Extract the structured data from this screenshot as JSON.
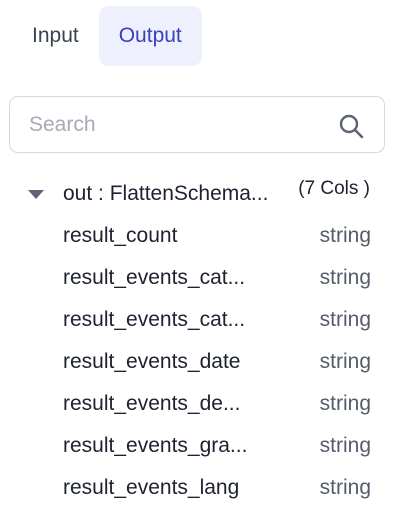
{
  "tabs": [
    {
      "label": "Input",
      "active": false
    },
    {
      "label": "Output",
      "active": true
    }
  ],
  "search": {
    "placeholder": "Search",
    "value": ""
  },
  "schema": {
    "name": "out : FlattenSchema...",
    "count": "(7 Cols )",
    "expanded": true
  },
  "fields": [
    {
      "name": "result_count",
      "type": "string"
    },
    {
      "name": "result_events_cat...",
      "type": "string"
    },
    {
      "name": "result_events_cat...",
      "type": "string"
    },
    {
      "name": "result_events_date",
      "type": "string"
    },
    {
      "name": "result_events_de...",
      "type": "string"
    },
    {
      "name": "result_events_gra...",
      "type": "string"
    },
    {
      "name": "result_events_lang",
      "type": "string"
    }
  ],
  "colors": {
    "active_tab_bg": "#eef0fd",
    "active_tab_text": "#3a3fc0",
    "text": "#1e2230",
    "muted": "#565c6c"
  }
}
